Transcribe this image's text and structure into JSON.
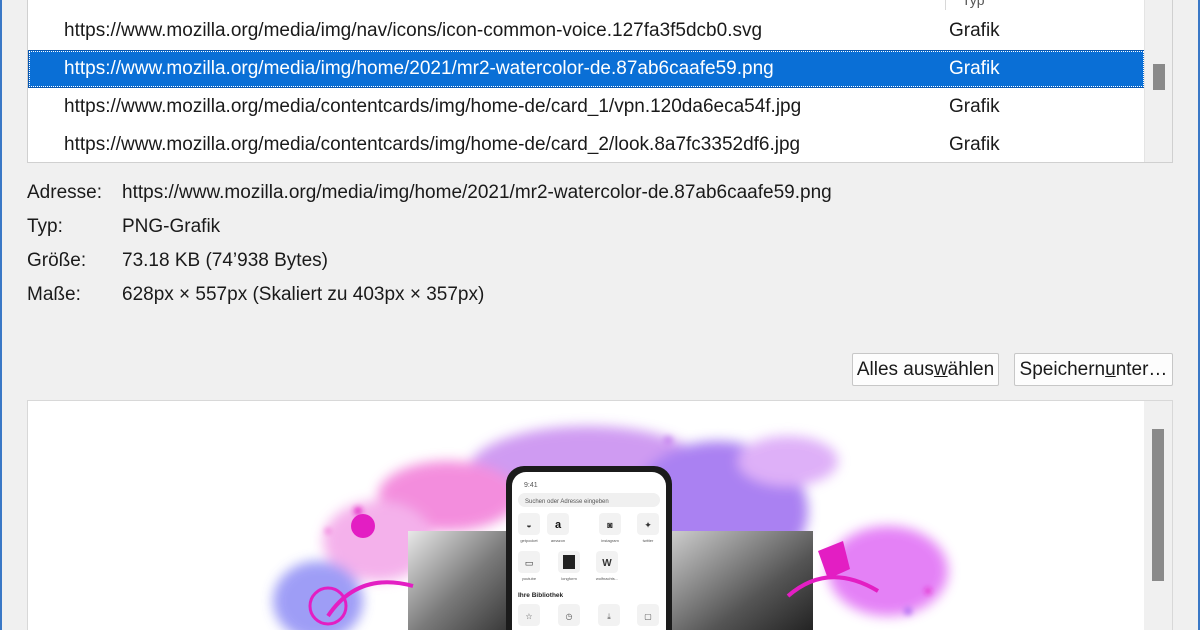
{
  "media_list": {
    "header_fragment": "Typ",
    "rows": [
      {
        "url": "https://www.mozilla.org/media/img/nav/icons/icon-common-voice.127fa3f5dcb0.svg",
        "type": "Grafik",
        "selected": false
      },
      {
        "url": "https://www.mozilla.org/media/img/home/2021/mr2-watercolor-de.87ab6caafe59.png",
        "type": "Grafik",
        "selected": true
      },
      {
        "url": "https://www.mozilla.org/media/contentcards/img/home-de/card_1/vpn.120da6eca54f.jpg",
        "type": "Grafik",
        "selected": false
      },
      {
        "url": "https://www.mozilla.org/media/contentcards/img/home-de/card_2/look.8a7fc3352df6.jpg",
        "type": "Grafik",
        "selected": false
      }
    ]
  },
  "details": {
    "address": {
      "label": "Adresse:",
      "value": "https://www.mozilla.org/media/img/home/2021/mr2-watercolor-de.87ab6caafe59.png"
    },
    "type": {
      "label": "Typ:",
      "value": "PNG-Grafik"
    },
    "size": {
      "label": "Größe:",
      "value": "73.18 KB (74’938 Bytes)"
    },
    "dimensions": {
      "label": "Maße:",
      "value": "628px × 557px (Skaliert zu 403px × 357px)"
    }
  },
  "buttons": {
    "select_all": {
      "before": "Alles aus",
      "accesskey": "w",
      "after": "ählen"
    },
    "save_as": {
      "before": "Speichern ",
      "accesskey": "u",
      "after": "nter…"
    }
  },
  "preview_phone": {
    "time": "9:41",
    "search_placeholder": "Suchen oder Adresse eingeben",
    "shortcuts": [
      "getpocket",
      "amazon",
      "instagram",
      "twitter",
      "youtube",
      "longform",
      "wolfnachts..."
    ],
    "library_heading": "Ihre Bibliothek"
  },
  "colors": {
    "selection": "#0a6fd6",
    "window_edge": "#3a78c6",
    "accent_magenta": "#e31ec3",
    "accent_violet": "#9a5ef0"
  }
}
